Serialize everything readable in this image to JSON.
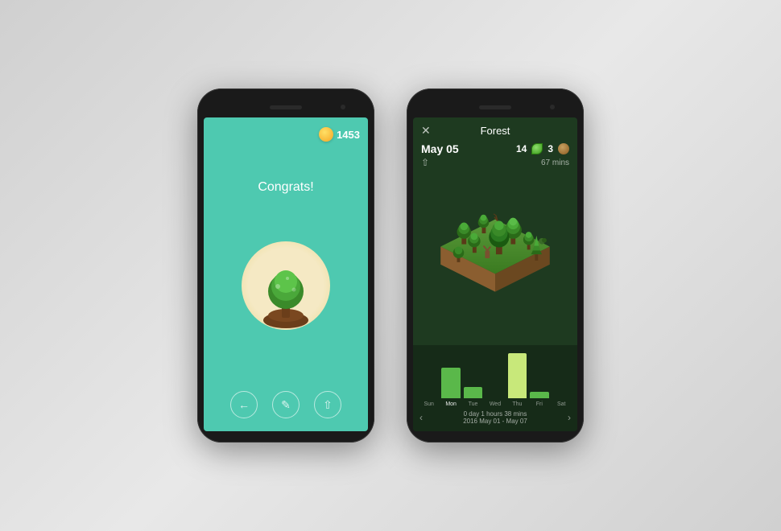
{
  "phone1": {
    "coin_count": "1453",
    "congrats_text": "Congrats!",
    "actions": [
      "back",
      "edit",
      "share"
    ]
  },
  "phone2": {
    "title": "Forest",
    "date": "May 05",
    "stat1_num": "14",
    "stat2_num": "3",
    "time_label": "67 mins",
    "chart": {
      "labels": [
        "Sun",
        "Mon",
        "Tue",
        "Wed",
        "Thu",
        "Fri",
        "Sat"
      ],
      "values": [
        0,
        35,
        10,
        0,
        55,
        5,
        0
      ],
      "active_day": "Mon"
    },
    "nav_text": "0 day 1 hours 38 mins",
    "nav_subtext": "2016 May 01 - May 07"
  }
}
